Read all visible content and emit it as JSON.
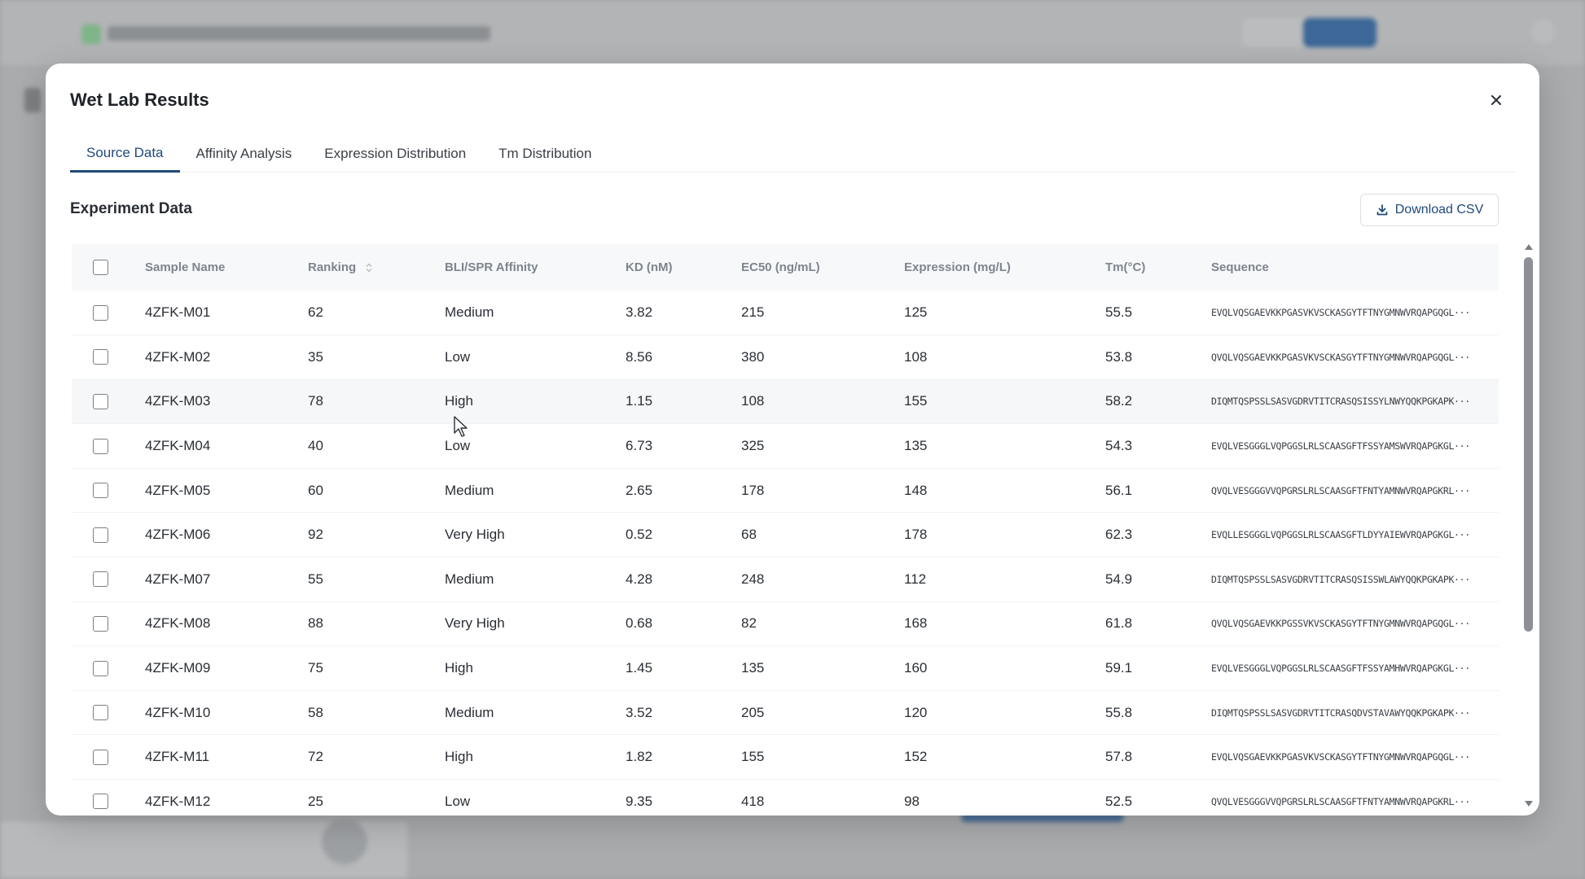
{
  "modal": {
    "title": "Wet Lab Results",
    "tabs": [
      {
        "label": "Source Data",
        "active": true
      },
      {
        "label": "Affinity Analysis",
        "active": false
      },
      {
        "label": "Expression Distribution",
        "active": false
      },
      {
        "label": "Tm Distribution",
        "active": false
      }
    ],
    "section_title": "Experiment Data",
    "download_label": "Download CSV",
    "accent_color": "#1f4a7a"
  },
  "table": {
    "columns": [
      "Sample Name",
      "Ranking",
      "BLI/SPR Affinity",
      "KD (nM)",
      "EC50 (ng/mL)",
      "Expression (mg/L)",
      "Tm(°C)",
      "Sequence"
    ],
    "rows": [
      [
        "4ZFK-M01",
        "62",
        "Medium",
        "3.82",
        "215",
        "125",
        "55.5",
        "EVQLVQSGAEVKKPGASVKVSCKASGYTFTNYGMNWVRQAPGQGL···"
      ],
      [
        "4ZFK-M02",
        "35",
        "Low",
        "8.56",
        "380",
        "108",
        "53.8",
        "QVQLVQSGAEVKKPGASVKVSCKASGYTFTNYGMNWVRQAPGQGL···"
      ],
      [
        "4ZFK-M03",
        "78",
        "High",
        "1.15",
        "108",
        "155",
        "58.2",
        "DIQMTQSPSSLSASVGDRVTITCRASQSISSYLNWYQQKPGKAPK···"
      ],
      [
        "4ZFK-M04",
        "40",
        "Low",
        "6.73",
        "325",
        "135",
        "54.3",
        "EVQLVESGGGLVQPGGSLRLSCAASGFTFSSYAMSWVRQAPGKGL···"
      ],
      [
        "4ZFK-M05",
        "60",
        "Medium",
        "2.65",
        "178",
        "148",
        "56.1",
        "QVQLVESGGGVVQPGRSLRLSCAASGFTFNTYAMNWVRQAPGKRL···"
      ],
      [
        "4ZFK-M06",
        "92",
        "Very High",
        "0.52",
        "68",
        "178",
        "62.3",
        "EVQLLESGGGLVQPGGSLRLSCAASGFTLDYYAIEWVRQAPGKGL···"
      ],
      [
        "4ZFK-M07",
        "55",
        "Medium",
        "4.28",
        "248",
        "112",
        "54.9",
        "DIQMTQSPSSLSASVGDRVTITCRASQSISSWLAWYQQKPGKAPK···"
      ],
      [
        "4ZFK-M08",
        "88",
        "Very High",
        "0.68",
        "82",
        "168",
        "61.8",
        "QVQLVQSGAEVKKPGSSVKVSCKASGYTFTNYGMNWVRQAPGQGL···"
      ],
      [
        "4ZFK-M09",
        "75",
        "High",
        "1.45",
        "135",
        "160",
        "59.1",
        "EVQLVESGGGLVQPGGSLRLSCAASGFTFSSYAMHWVRQAPGKGL···"
      ],
      [
        "4ZFK-M10",
        "58",
        "Medium",
        "3.52",
        "205",
        "120",
        "55.8",
        "DIQMTQSPSSLSASVGDRVTITCRASQDVSTAVAWYQQKPGKAPK···"
      ],
      [
        "4ZFK-M11",
        "72",
        "High",
        "1.82",
        "155",
        "152",
        "57.8",
        "EVQLVQSGAEVKKPGASVKVSCKASGYTFTNYGMNWVRQAPGQGL···"
      ],
      [
        "4ZFK-M12",
        "25",
        "Low",
        "9.35",
        "418",
        "98",
        "52.5",
        "QVQLVESGGGVVQPGRSLRLSCAASGFTFNTYAMNWVRQAPGKRL···"
      ]
    ]
  },
  "icons": {
    "close": "close-icon",
    "download": "download-icon",
    "sort": "sort-icon",
    "cursor": "mouse-cursor"
  }
}
